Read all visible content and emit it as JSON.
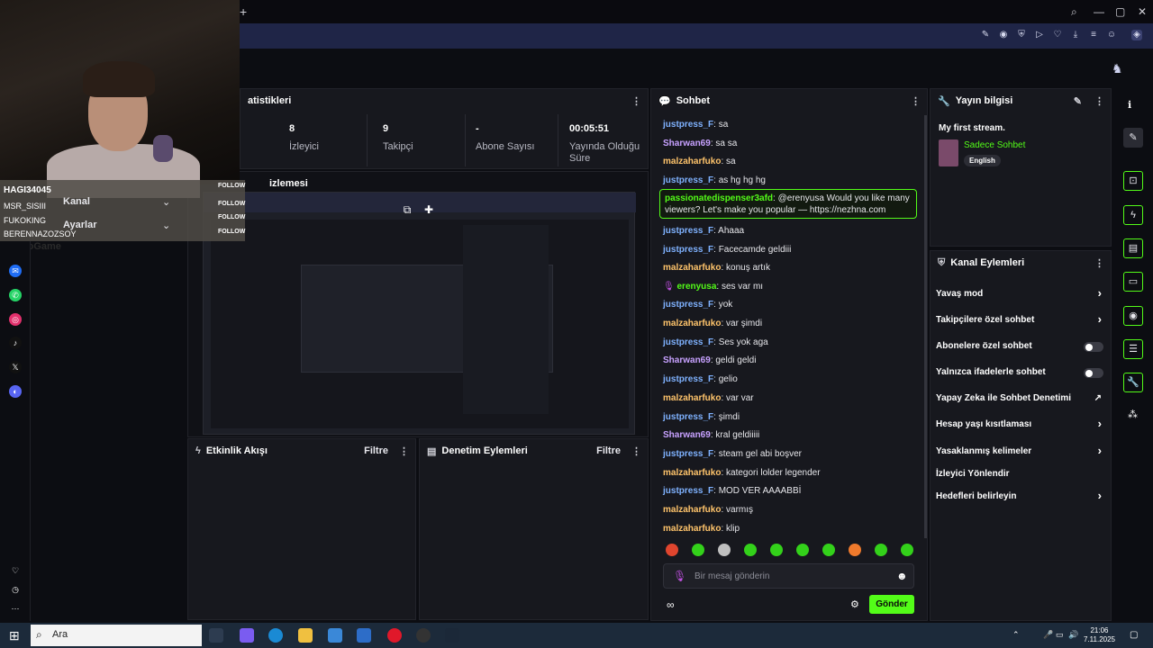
{
  "stats": {
    "title": "atistikleri",
    "items": [
      {
        "value": "8",
        "label": "İzleyici"
      },
      {
        "value": "9",
        "label": "Takipçi"
      },
      {
        "value": "-",
        "label": "Abone Sayısı"
      },
      {
        "value": "00:05:51",
        "label": "Yayında Olduğu Süre"
      }
    ]
  },
  "preview": {
    "title": "izlemesi"
  },
  "events": {
    "title": "Etkinlik Akışı",
    "filter": "Filtre"
  },
  "moderation": {
    "title": "Denetim Eylemleri",
    "filter": "Filtre"
  },
  "chat": {
    "title": "Sohbet",
    "messages": [
      {
        "user": "justpress_F",
        "text": "sa",
        "color": "blue"
      },
      {
        "user": "Sharwan69",
        "text": "sa sa",
        "color": "purple"
      },
      {
        "user": "malzaharfuko",
        "text": "sa",
        "color": "orange"
      },
      {
        "user": "justpress_F",
        "text": "as hg hg hg",
        "color": "blue"
      },
      {
        "user": "justpress_F",
        "text": "Ahaaa",
        "color": "blue"
      },
      {
        "user": "justpress_F",
        "text": "Facecamde geldiii",
        "color": "blue"
      },
      {
        "user": "malzaharfuko",
        "text": "konuş artık",
        "color": "orange"
      },
      {
        "user": "erenyusa",
        "text": "ses var mı",
        "color": "green"
      },
      {
        "user": "justpress_F",
        "text": "yok",
        "color": "blue"
      },
      {
        "user": "malzaharfuko",
        "text": "var şimdi",
        "color": "orange"
      },
      {
        "user": "justpress_F",
        "text": "Ses yok aga",
        "color": "blue"
      },
      {
        "user": "Sharwan69",
        "text": "geldi geldi",
        "color": "purple"
      },
      {
        "user": "justpress_F",
        "text": "gelio",
        "color": "blue"
      },
      {
        "user": "malzaharfuko",
        "text": "var var",
        "color": "orange"
      },
      {
        "user": "justpress_F",
        "text": "şimdi",
        "color": "blue"
      },
      {
        "user": "Sharwan69",
        "text": "kral geldiiiii",
        "color": "purple"
      },
      {
        "user": "justpress_F",
        "text": "steam gel abi boşver",
        "color": "blue"
      },
      {
        "user": "malzaharfuko",
        "text": "kategori lolder legender",
        "color": "orange"
      },
      {
        "user": "justpress_F",
        "text": "MOD VER AAAABBİ",
        "color": "blue"
      },
      {
        "user": "malzaharfuko",
        "text": "varmış",
        "color": "orange"
      },
      {
        "user": "malzaharfuko",
        "text": "klip",
        "color": "orange"
      }
    ],
    "highlight": {
      "user": "passionatedispenser3afd",
      "text": "@erenyusa Would you like many viewers? Let's make you popular — https://nezhna.com"
    },
    "input_placeholder": "Bir mesaj gönderin",
    "send_label": "Gönder"
  },
  "stream_info": {
    "title": "Yayın bilgisi",
    "stream_title": "My first stream.",
    "category": "Sadece Sohbet",
    "language": "English"
  },
  "channel_actions": {
    "title": "Kanal Eylemleri",
    "items": [
      {
        "label": "Yavaş mod",
        "control": "chevron"
      },
      {
        "label": "Takipçilere özel sohbet",
        "control": "chevron"
      },
      {
        "label": "Abonelere özel sohbet",
        "control": "toggle"
      },
      {
        "label": "Yalnızca ifadelerle sohbet",
        "control": "toggle"
      },
      {
        "label": "Yapay Zeka ile Sohbet Denetimi",
        "control": "external"
      },
      {
        "label": "Hesap yaşı kısıtlaması",
        "control": "chevron"
      },
      {
        "label": "Yasaklanmış kelimeler",
        "control": "chevron"
      },
      {
        "label": "İzleyici Yönlendir",
        "control": "none"
      },
      {
        "label": "Hedefleri belirleyin",
        "control": "chevron"
      }
    ]
  },
  "overlay": {
    "names": [
      "HAGI34045",
      "MSR_SISIII",
      "FUKOKING",
      "BERENNAZOZSOY"
    ],
    "follow_label": "FOLLOW",
    "menu": [
      "Kanal",
      "Ayarlar"
    ],
    "watermark": "BuNoGame"
  },
  "taskbar": {
    "search_label": "Ara",
    "time": "21:06",
    "date": "7.11.2025"
  },
  "colors": {
    "accent": "#53fc18",
    "panel": "#17181e",
    "background": "#0c0d12"
  }
}
